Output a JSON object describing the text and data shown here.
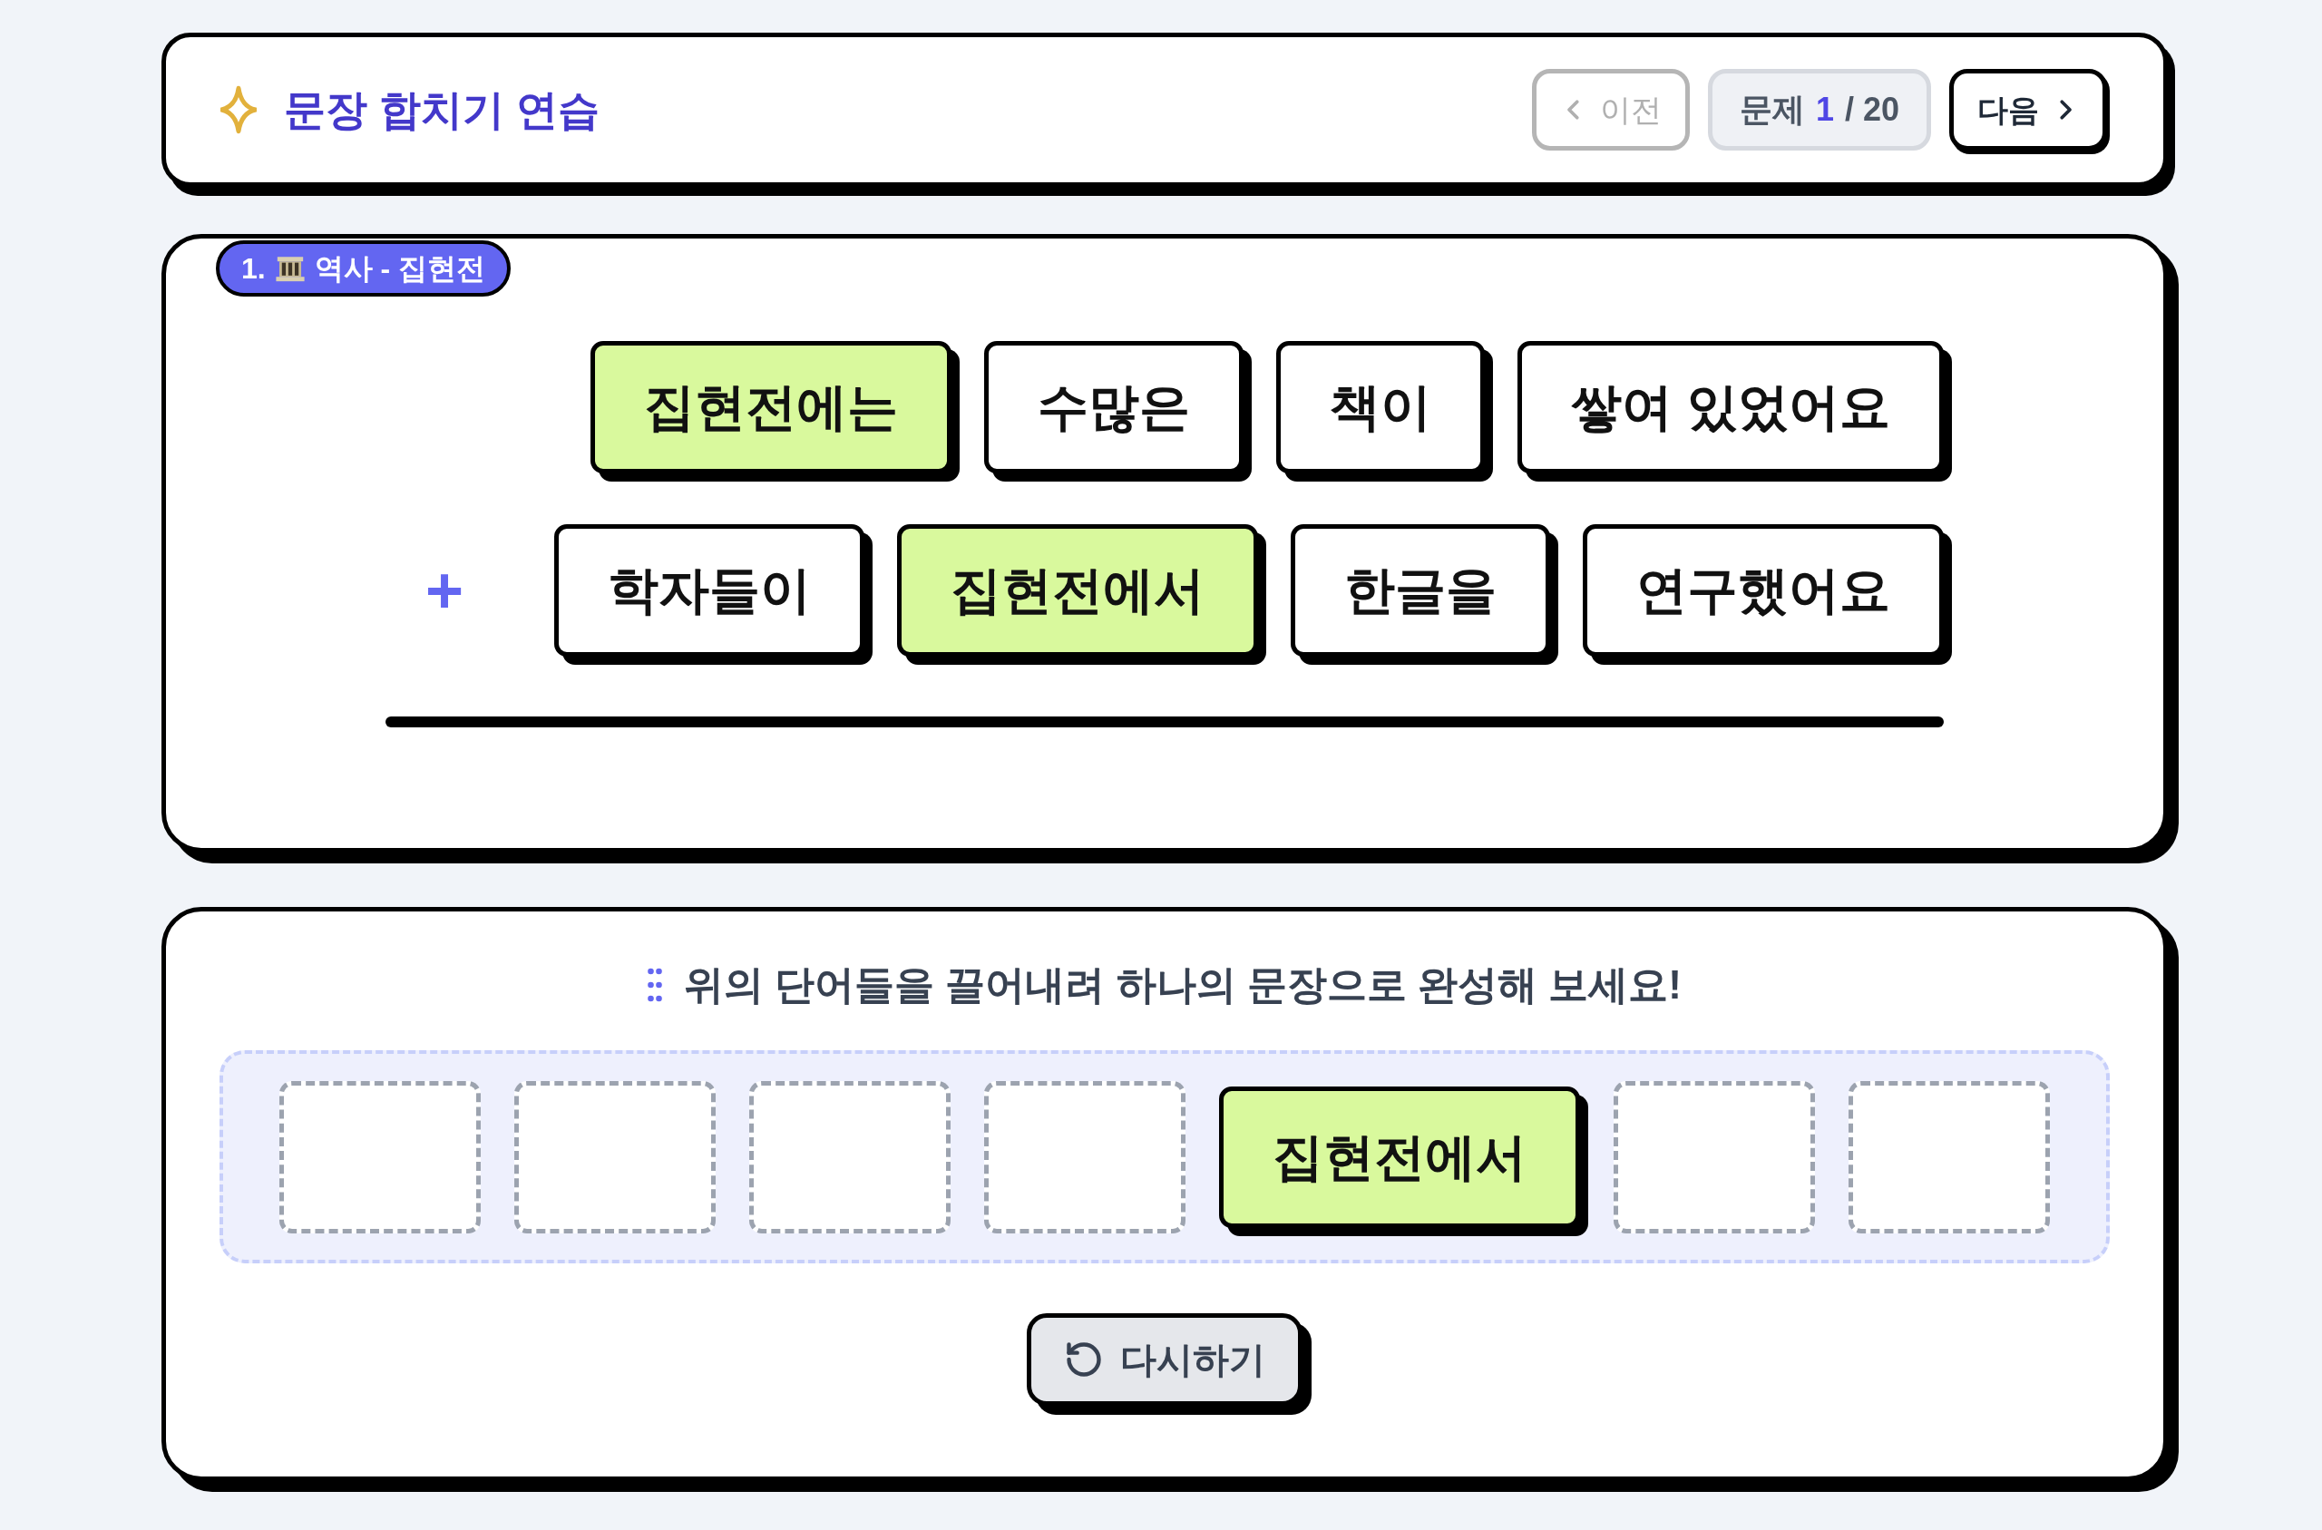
{
  "header": {
    "title": "문장 합치기 연습",
    "prev_button": {
      "label": "이전",
      "disabled": true
    },
    "counter": {
      "label": "문제",
      "current": "1",
      "total": "/ 20"
    },
    "next_button": {
      "label": "다음",
      "disabled": false
    }
  },
  "question": {
    "badge": {
      "number": "1.",
      "label": "역사 - 집현전"
    },
    "sentences": [
      {
        "words": [
          {
            "text": "집현전에는",
            "highlighted": true
          },
          {
            "text": "수많은",
            "highlighted": false
          },
          {
            "text": "책이",
            "highlighted": false
          },
          {
            "text": "쌓여 있었어요",
            "highlighted": false
          }
        ]
      },
      {
        "prefix": "+",
        "words": [
          {
            "text": "학자들이",
            "highlighted": false
          },
          {
            "text": "집현전에서",
            "highlighted": true
          },
          {
            "text": "한글을",
            "highlighted": false
          },
          {
            "text": "연구했어요",
            "highlighted": false
          }
        ]
      }
    ]
  },
  "answer": {
    "instruction": "위의 단어들을 끌어내려 하나의 문장으로 완성해 보세요!",
    "slots": [
      {
        "kind": "empty"
      },
      {
        "kind": "empty"
      },
      {
        "kind": "empty"
      },
      {
        "kind": "empty"
      },
      {
        "kind": "word",
        "text": "집현전에서",
        "highlighted": true
      },
      {
        "kind": "empty"
      },
      {
        "kind": "empty"
      }
    ],
    "reset_button": {
      "label": "다시하기"
    }
  }
}
